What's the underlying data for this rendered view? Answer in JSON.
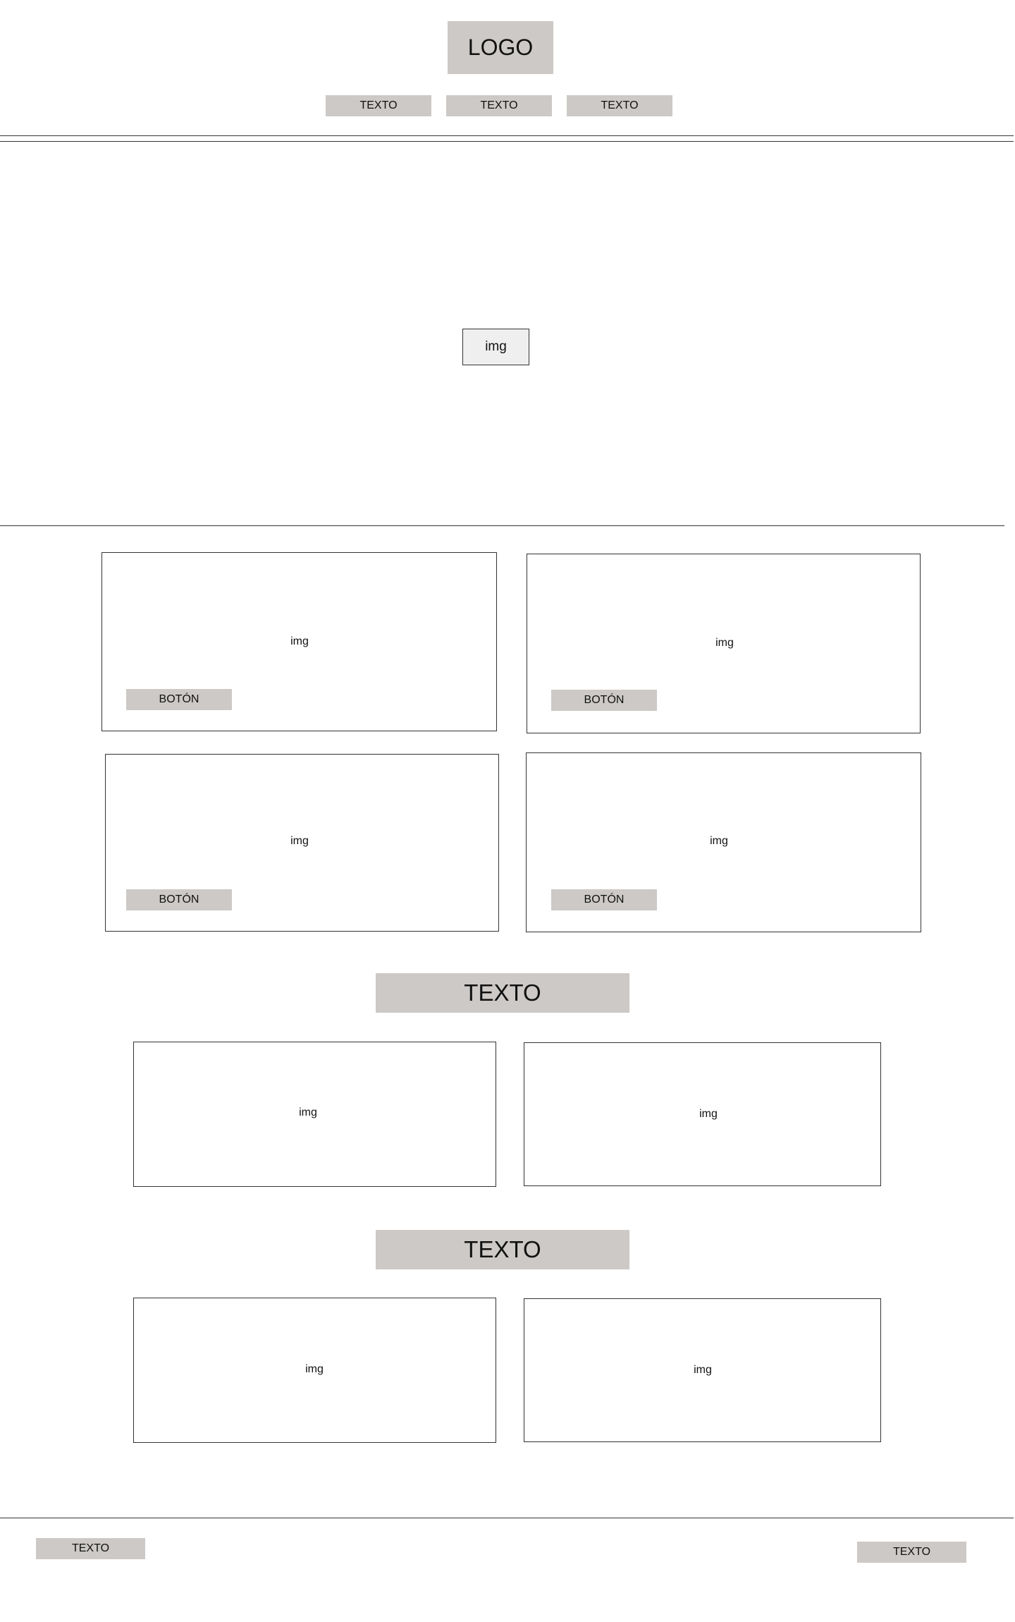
{
  "header": {
    "logo": "LOGO",
    "nav": [
      "TEXTO",
      "TEXTO",
      "TEXTO"
    ]
  },
  "hero": {
    "image_label": "img"
  },
  "product_cards": [
    {
      "image_label": "img",
      "button_label": "BOTÓN"
    },
    {
      "image_label": "img",
      "button_label": "BOTÓN"
    },
    {
      "image_label": "img",
      "button_label": "BOTÓN"
    },
    {
      "image_label": "img",
      "button_label": "BOTÓN"
    }
  ],
  "sections": [
    {
      "title": "TEXTO",
      "images": [
        "img",
        "img"
      ]
    },
    {
      "title": "TEXTO",
      "images": [
        "img",
        "img"
      ]
    }
  ],
  "footer": {
    "left_label": "TEXTO",
    "right_label": "TEXTO"
  },
  "colors": {
    "placeholder_fill": "#ccc9c6",
    "hero_image_fill": "#efefef",
    "outline": "#333333",
    "background": "#ffffff"
  }
}
